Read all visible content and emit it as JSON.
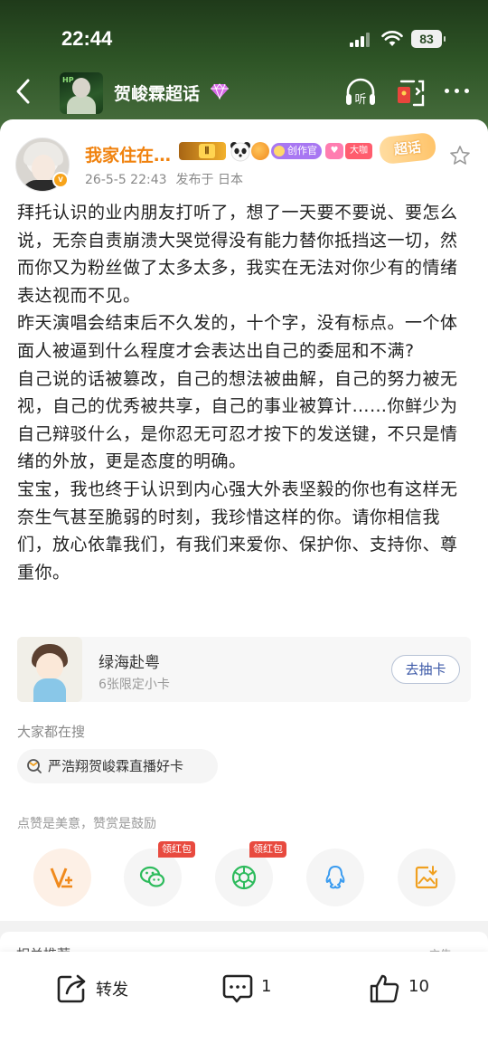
{
  "status_bar": {
    "time": "22:44",
    "battery": "83"
  },
  "nav": {
    "title": "贺峻霖超话"
  },
  "post": {
    "author": "我家住在…",
    "level": "Ⅱ",
    "badge_creator": "创作官",
    "badge_big": "大咖",
    "badge_super": "超话",
    "time": "26-5-5 22:43",
    "location": "发布于 日本",
    "paragraphs": [
      "拜托认识的业内朋友打听了，想了一天要不要说、要怎么说，无奈自责崩溃大哭觉得没有能力替你抵挡这一切，然而你又为粉丝做了太多太多，我实在无法对你少有的情绪表达视而不见。",
      "昨天演唱会结束后不久发的，十个字，没有标点。一个体面人被逼到什么程度才会表达出自己的委屈和不满?",
      "自己说的话被篡改，自己的想法被曲解，自己的努力被无视，自己的优秀被共享，自己的事业被算计……你鲜少为自己辩驳什么，是你忍无可忍才按下的发送键，不只是情绪的外放，更是态度的明确。",
      "宝宝，我也终于认识到内心强大外表坚毅的你也有这样无奈生气甚至脆弱的时刻，我珍惜这样的你。请你相信我们，放心依靠我们，有我们来爱你、保护你、支持你、尊重你。"
    ]
  },
  "promo": {
    "title": "绿海赴粤",
    "subtitle": "6张限定小卡",
    "button": "去抽卡"
  },
  "search": {
    "title": "大家都在搜",
    "chip": "严浩翔贺峻霖直播好卡"
  },
  "reward_hint": "点赞是美意，赞赏是鼓励",
  "share": {
    "hongbao_label": "领红包"
  },
  "related": {
    "title": "相关推荐",
    "ad": "广告"
  },
  "actions": {
    "repost": "转发",
    "comments": "1",
    "likes": "10"
  },
  "colors": {
    "username": "#f0820e",
    "wechat": "#2dbb5c",
    "qq": "#3b9cf0",
    "reward": "#f08a1d"
  }
}
